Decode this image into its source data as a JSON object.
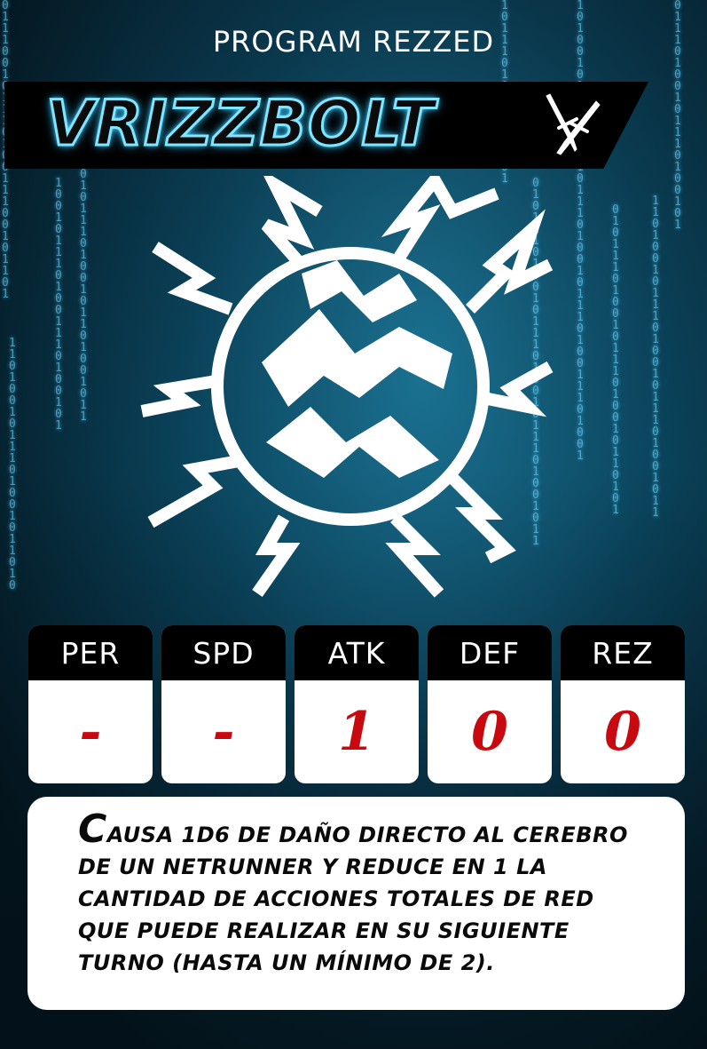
{
  "header": {
    "subtitle": "PROGRAM REZZED"
  },
  "card": {
    "name": "VRIZZBOLT",
    "type_icon": "crossed-daggers-icon",
    "emblem_icon": "lightning-globe-icon"
  },
  "stats": [
    {
      "label": "PER",
      "value": "-"
    },
    {
      "label": "SPD",
      "value": "-"
    },
    {
      "label": "ATK",
      "value": "1"
    },
    {
      "label": "DEF",
      "value": "0"
    },
    {
      "label": "REZ",
      "value": "0"
    }
  ],
  "description": {
    "first_letter": "C",
    "rest": "ausa 1D6 de daño directo al cerebro de un Netrunner y reduce en 1 la cantidad de acciones totales de Red que puede realizar en su siguiente turno (hasta un mínimo de 2)."
  },
  "colors": {
    "value_red": "#c8090f",
    "name_glow": "#7fe6ff",
    "background": "#0b4a62"
  }
}
